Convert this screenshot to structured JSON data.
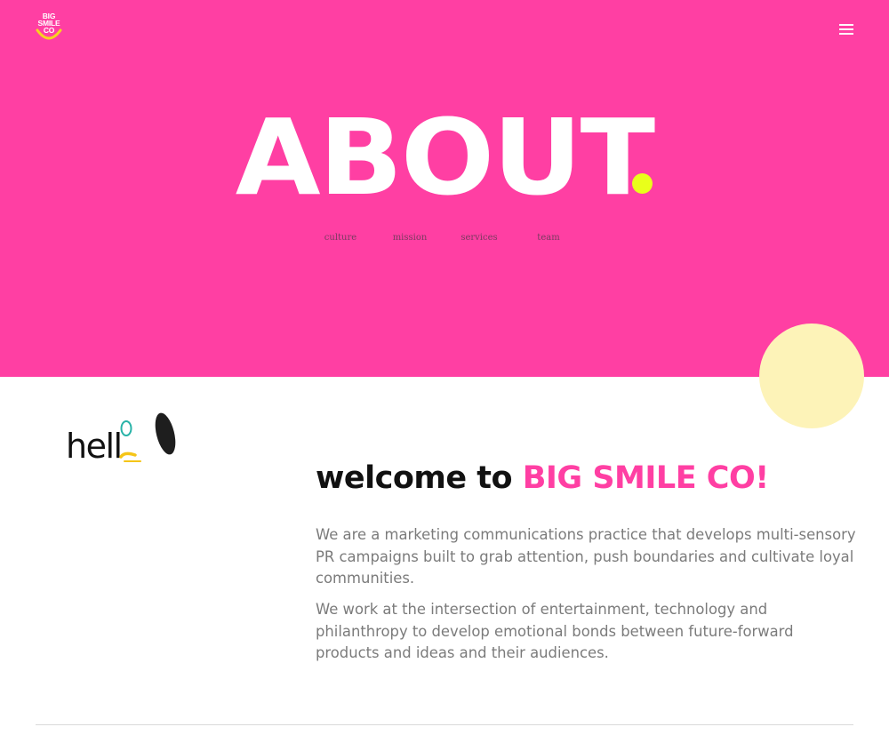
{
  "brand": {
    "logo_lines": [
      "BIG",
      "SMILE",
      "CO"
    ]
  },
  "header": {
    "menu_icon": "hamburger-menu-icon"
  },
  "hero": {
    "title": "ABOUT",
    "subnav": [
      "culture",
      "mission",
      "services",
      "team"
    ]
  },
  "intro": {
    "hello_text": "hell",
    "welcome_prefix": "welcome to ",
    "welcome_brand": "BIG SMILE CO!",
    "paragraphs": [
      "We are a marketing communications practice that develops multi-sensory PR campaigns built to grab attention, push boundaries and cultivate loyal communities.",
      "We work at the intersection of entertainment, technology and philanthropy to develop emotional bonds between future-forward products and ideas and their audiences."
    ]
  },
  "colors": {
    "brand_pink": "#ff3fa3",
    "accent_yellow": "#e9ff1a",
    "pale_yellow": "#fdf3b8",
    "body_text": "#7b7b7b",
    "heading_text": "#111111"
  }
}
